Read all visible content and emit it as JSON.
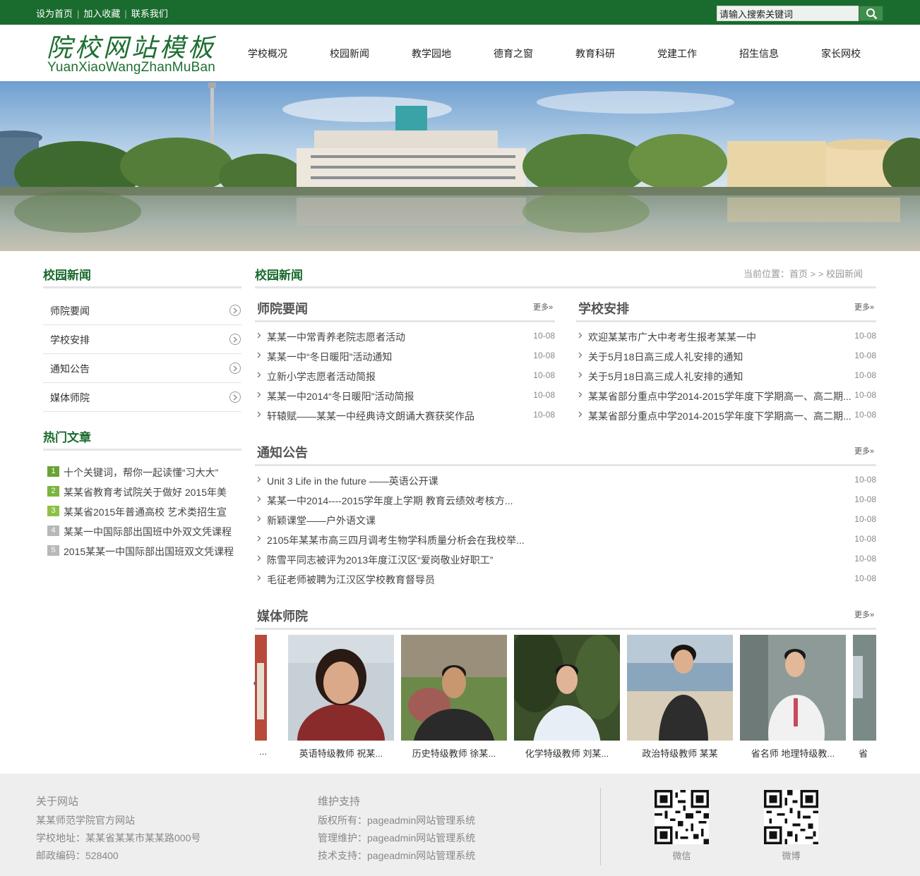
{
  "topbar": {
    "links": [
      "设为首页",
      "加入收藏",
      "联系我们"
    ],
    "search_placeholder": "请输入搜索关键词",
    "bg_color": "#1a6b2e"
  },
  "header": {
    "logo_cn": "院校网站模板",
    "logo_en": "YuanXiaoWangZhanMuBan",
    "nav": [
      "学校概况",
      "校园新闻",
      "教学园地",
      "德育之窗",
      "教育科研",
      "党建工作",
      "招生信息",
      "家长网校"
    ]
  },
  "sidebar": {
    "title": "校园新闻",
    "items": [
      "师院要闻",
      "学校安排",
      "通知公告",
      "媒体师院"
    ],
    "hot_title": "热门文章",
    "hot": [
      {
        "num": "1",
        "text": "十个关键词，帮你一起读懂“习大大”",
        "color": "#6aa334"
      },
      {
        "num": "2",
        "text": "某某省教育考试院关于做好 2015年美",
        "color": "#7bb53f"
      },
      {
        "num": "3",
        "text": "某某省2015年普通高校 艺术类招生宣",
        "color": "#8cc146"
      },
      {
        "num": "4",
        "text": "某某一中国际部出国班中外双文凭课程",
        "color": "#b8b8b8"
      },
      {
        "num": "5",
        "text": "2015某某一中国际部出国班双文凭课程",
        "color": "#b8b8b8"
      }
    ]
  },
  "main": {
    "title": "校园新闻",
    "breadcrumb": "当前位置：首页 > > 校园新闻",
    "more_label": "更多»",
    "news": {
      "title": "师院要闻",
      "items": [
        {
          "text": "某某一中常青养老院志愿者活动",
          "date": "10-08"
        },
        {
          "text": "某某一中“冬日暖阳”活动通知",
          "date": "10-08"
        },
        {
          "text": "立新小学志愿者活动简报",
          "date": "10-08"
        },
        {
          "text": "某某一中2014“冬日暖阳”活动简报",
          "date": "10-08"
        },
        {
          "text": "轩辕赋——某某一中经典诗文朗诵大赛获奖作品",
          "date": "10-08"
        }
      ]
    },
    "schedule": {
      "title": "学校安排",
      "items": [
        {
          "text": "欢迎某某市广大中考考生报考某某一中",
          "date": "10-08"
        },
        {
          "text": "关于5月18日高三成人礼安排的通知",
          "date": "10-08"
        },
        {
          "text": "关于5月18日高三成人礼安排的通知",
          "date": "10-08"
        },
        {
          "text": "某某省部分重点中学2014-2015学年度下学期高一、高二期...",
          "date": "10-08"
        },
        {
          "text": "某某省部分重点中学2014-2015学年度下学期高一、高二期...",
          "date": "10-08"
        }
      ]
    },
    "notice": {
      "title": "通知公告",
      "items": [
        {
          "text": "Unit 3 Life in the future ——英语公开课",
          "date": "10-08"
        },
        {
          "text": "某某一中2014----2015学年度上学期 教育云绩效考核方...",
          "date": "10-08"
        },
        {
          "text": "新颖课堂——户外语文课",
          "date": "10-08"
        },
        {
          "text": "2105年某某市高三四月调考生物学科质量分析会在我校举...",
          "date": "10-08"
        },
        {
          "text": "陈雪平同志被评为2013年度江汉区“爱岗敬业好职工”",
          "date": "10-08"
        },
        {
          "text": "毛征老师被聘为江汉区学校教育督导员",
          "date": "10-08"
        }
      ]
    },
    "media": {
      "title": "媒体师院",
      "partial_left_caption": "...",
      "partial_right_caption": "省",
      "cards": [
        {
          "caption": "英语特级教师 祝某...",
          "bg": "#c7cfd7",
          "face": "#d9a98a",
          "cloth": "#8a2b2b",
          "hair": "#2a1a14"
        },
        {
          "caption": "历史特级教师 徐某...",
          "bg": "#6b8a4a",
          "face": "#c9976f",
          "cloth": "#2a2a2a",
          "hair": "#1e1a18"
        },
        {
          "caption": "化学特级教师 刘某...",
          "bg": "#3b4f2a",
          "face": "#e0b596",
          "cloth": "#e8eef6",
          "hair": "#141414"
        },
        {
          "caption": "政治特级教师 某某",
          "bg": "#b9c9d6",
          "face": "#dcb08f",
          "cloth": "#2d2d2d",
          "hair": "#1a1410"
        },
        {
          "caption": "省名师 地理特级教...",
          "bg": "#8e9a98",
          "face": "#e3b898",
          "cloth": "#f1f1f1",
          "hair": "#1a1a1a"
        }
      ]
    }
  },
  "footer": {
    "about_title": "关于网站",
    "about_lines": [
      "某某师范学院官方网站",
      "学校地址：某某省某某市某某路000号",
      "邮政编码：528400"
    ],
    "support_title": "维护支持",
    "support_lines": [
      "版权所有：pageadmin网站管理系统",
      "管理维护：pageadmin网站管理系统",
      "技术支持：pageadmin网站管理系统"
    ],
    "qr": [
      "微信",
      "微博"
    ]
  }
}
